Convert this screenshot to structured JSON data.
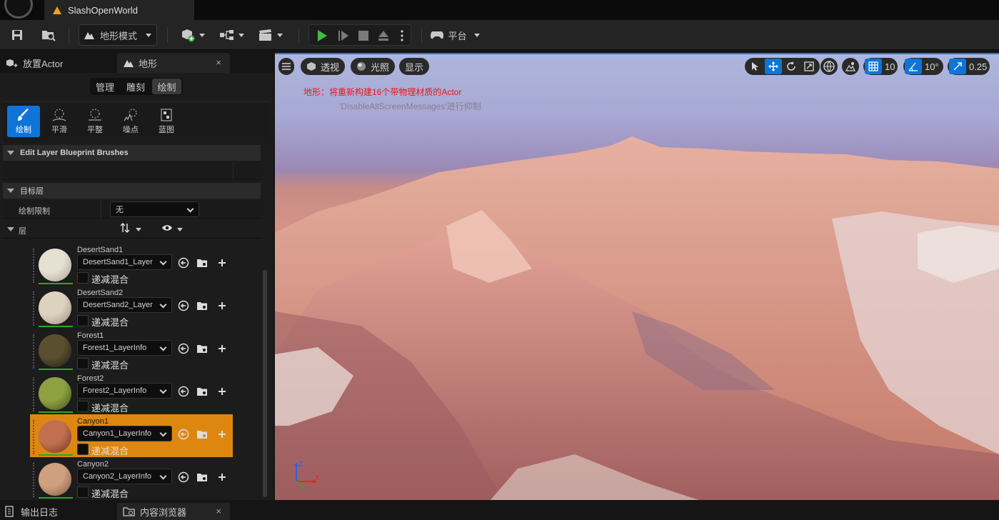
{
  "window": {
    "title": "SlashOpenWorld"
  },
  "toolbar": {
    "mode_label": "地形模式",
    "platform_label": "平台"
  },
  "left_panel": {
    "tabs": [
      {
        "label": "放置Actor"
      },
      {
        "label": "地形",
        "close": "×"
      }
    ],
    "segments": [
      "管理",
      "雕刻",
      "绘制"
    ],
    "active_segment": "绘制",
    "tools": [
      {
        "label": "绘制",
        "icon": "paint-brush-icon",
        "active": true
      },
      {
        "label": "平滑",
        "icon": "smooth-icon",
        "active": false
      },
      {
        "label": "平整",
        "icon": "flatten-icon",
        "active": false
      },
      {
        "label": "噪点",
        "icon": "noise-icon",
        "active": false
      },
      {
        "label": "蓝图",
        "icon": "blueprint-icon",
        "active": false
      }
    ],
    "section_brushes": "Edit Layer Blueprint Brushes",
    "section_target": "目标层",
    "paint_limit": {
      "label": "绘制限制",
      "value": "无"
    },
    "layers_header": "层",
    "layers": [
      {
        "name": "DesertSand1",
        "info": "DesertSand1_Layer",
        "blend_label": "递减混合",
        "color": "#e6e0d2",
        "shade": "#a99f8e",
        "selected": false
      },
      {
        "name": "DesertSand2",
        "info": "DesertSand2_Layer",
        "blend_label": "递减混合",
        "color": "#dcd2c0",
        "shade": "#9d8f7a",
        "selected": false
      },
      {
        "name": "Forest1",
        "info": "Forest1_LayerInfo",
        "blend_label": "递减混合",
        "color": "#5a5030",
        "shade": "#1e1a10",
        "selected": false
      },
      {
        "name": "Forest2",
        "info": "Forest2_LayerInfo",
        "blend_label": "递减混合",
        "color": "#8fa040",
        "shade": "#3f5218",
        "selected": false
      },
      {
        "name": "Canyon1",
        "info": "Canyon1_LayerInfo",
        "blend_label": "递减混合",
        "color": "#c07050",
        "shade": "#6a3422",
        "selected": true
      },
      {
        "name": "Canyon2",
        "info": "Canyon2_LayerInfo",
        "blend_label": "递减混合",
        "color": "#cfa080",
        "shade": "#7e5a40",
        "selected": false
      }
    ]
  },
  "viewport": {
    "perspective_label": "透视",
    "lighting_label": "光照",
    "show_label": "显示",
    "grid_value": "10",
    "angle_value": "10°",
    "scale_value": "0.25",
    "message_main": "地形：将重新构建16个带物理材质的Actor",
    "message_sub": "'DisableAllScreenMessages'进行抑制",
    "colors": {
      "accent": "#0e74d8",
      "warning": "#e81818",
      "selected_layer": "#dd8711"
    }
  },
  "bottom_bar": {
    "output_log": "输出日志",
    "content_browser": "内容浏览器",
    "close": "×"
  }
}
